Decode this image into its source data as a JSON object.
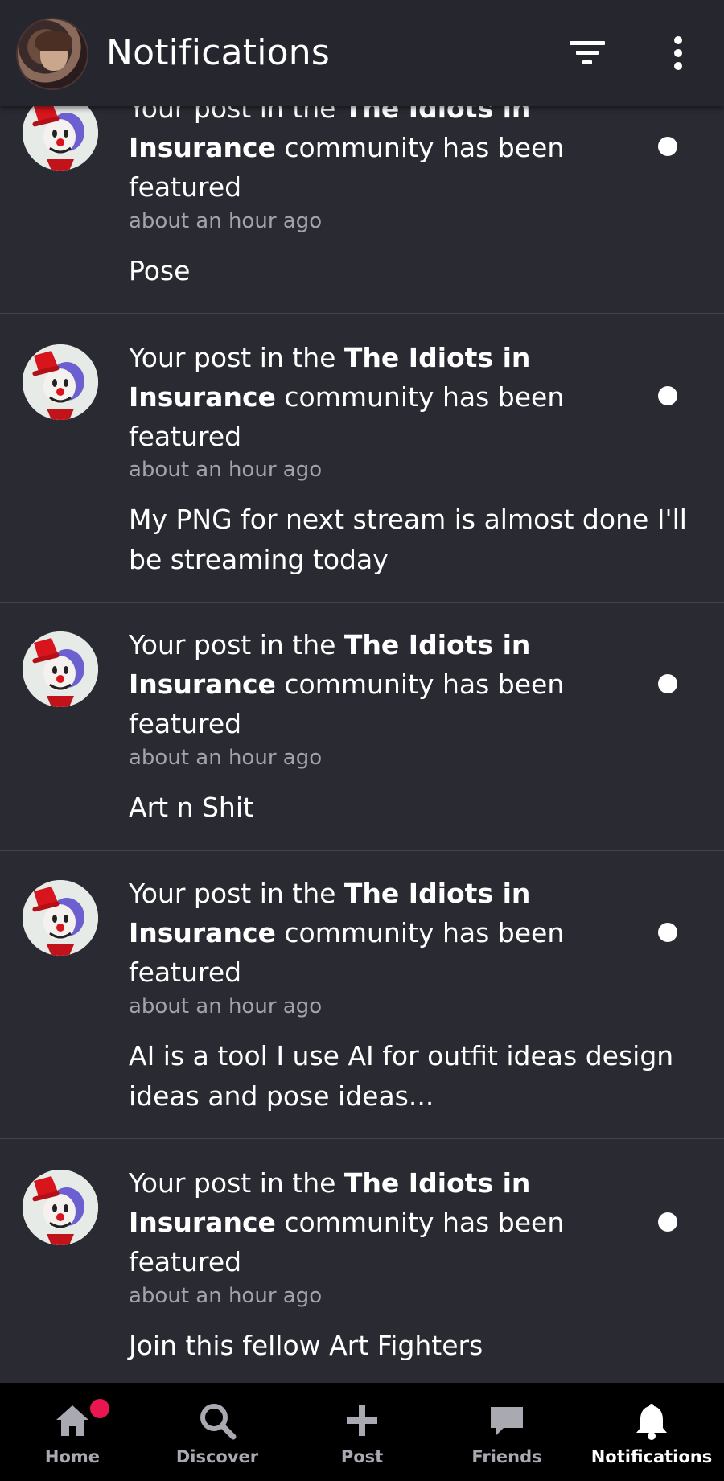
{
  "header": {
    "title": "Notifications",
    "profile_icon": "user-avatar",
    "filter_icon": "filter-icon",
    "more_icon": "more-vertical-icon"
  },
  "notifications": [
    {
      "prefix": "Your post in the ",
      "community": "The Idiots in Insurance",
      "suffix": " community has been featured",
      "time": "about an hour ago",
      "preview": "Pose",
      "unread": true
    },
    {
      "prefix": "Your post in the ",
      "community": "The Idiots in Insurance",
      "suffix": " community has been featured",
      "time": "about an hour ago",
      "preview": "My PNG for next stream is almost done I'll be streaming today",
      "unread": true
    },
    {
      "prefix": "Your post in the ",
      "community": "The Idiots in Insurance",
      "suffix": " community has been featured",
      "time": "about an hour ago",
      "preview": "Art n Shit",
      "unread": true
    },
    {
      "prefix": "Your post in the ",
      "community": "The Idiots in Insurance",
      "suffix": " community has been featured",
      "time": "about an hour ago",
      "preview": "AI is a tool I use AI for outfit ideas design ideas and pose ideas...",
      "unread": true
    },
    {
      "prefix": "Your post in the ",
      "community": "The Idiots in Insurance",
      "suffix": " community has been featured",
      "time": "about an hour ago",
      "preview": "Join this fellow Art Fighters",
      "unread": true
    }
  ],
  "bottom_nav": {
    "items": [
      {
        "label": "Home",
        "icon": "home-icon",
        "badge": true
      },
      {
        "label": "Discover",
        "icon": "search-icon"
      },
      {
        "label": "Post",
        "icon": "plus-icon"
      },
      {
        "label": "Friends",
        "icon": "chat-icon"
      },
      {
        "label": "Notifications",
        "icon": "bell-icon",
        "active": true
      }
    ]
  },
  "colors": {
    "background": "#2a2a32",
    "header": "#26262e",
    "nav": "#000000",
    "badge": "#e8174f",
    "muted_text": "#a3a3ab"
  }
}
